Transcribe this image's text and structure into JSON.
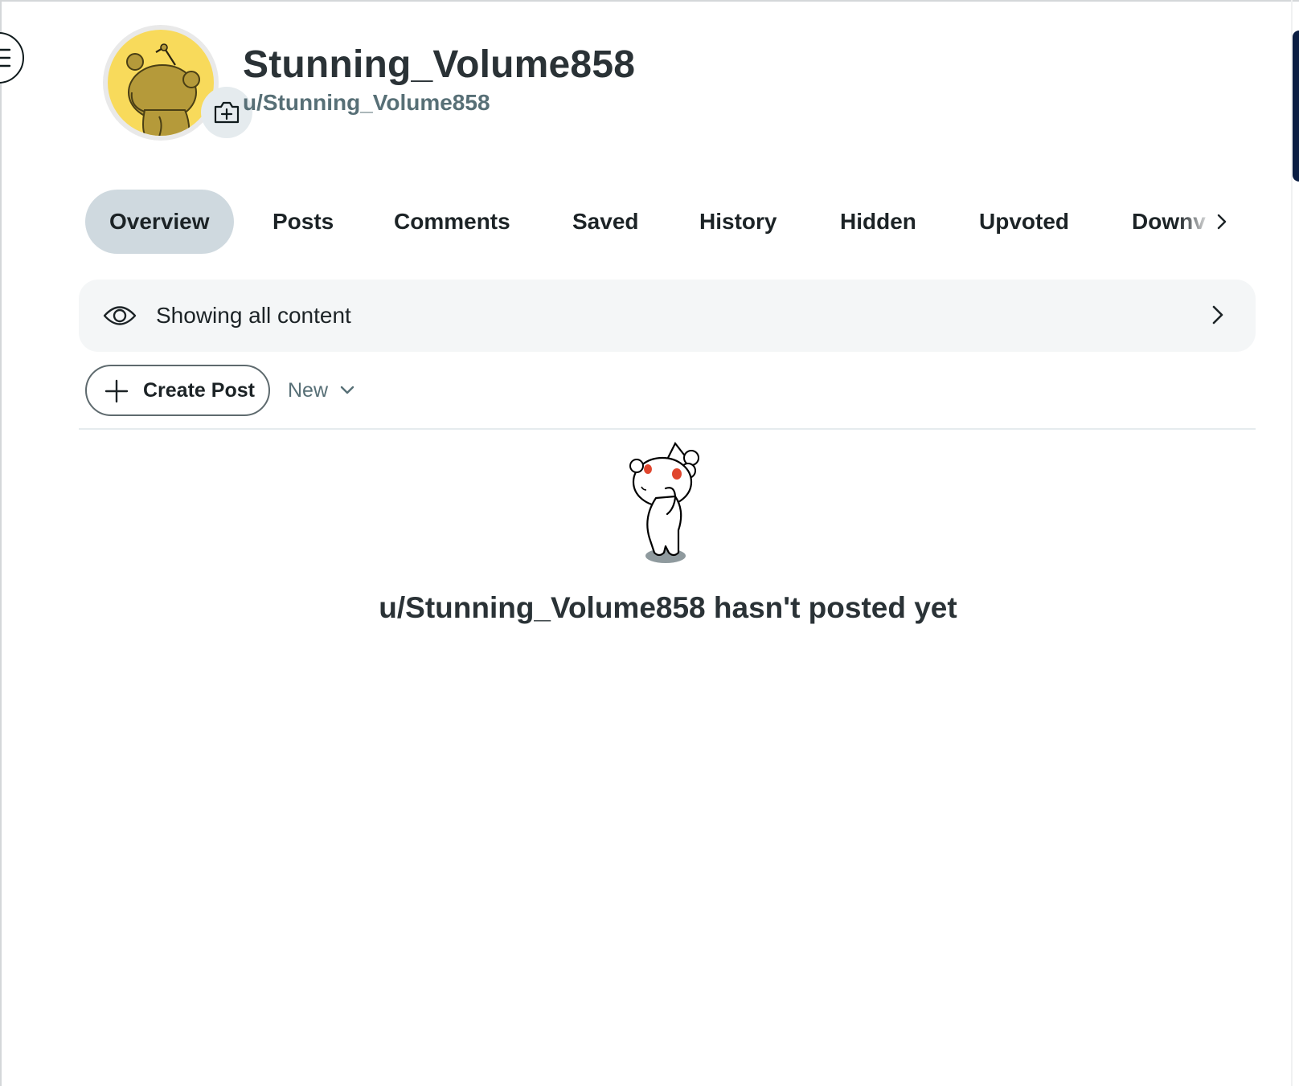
{
  "profile": {
    "display_name": "Stunning_Volume858",
    "username": "u/Stunning_Volume858",
    "avatar_color": "#f8da5b"
  },
  "tabs": [
    {
      "label": "Overview",
      "active": true
    },
    {
      "label": "Posts",
      "active": false
    },
    {
      "label": "Comments",
      "active": false
    },
    {
      "label": "Saved",
      "active": false
    },
    {
      "label": "History",
      "active": false
    },
    {
      "label": "Hidden",
      "active": false
    },
    {
      "label": "Upvoted",
      "active": false
    },
    {
      "label": "Downv",
      "active": false
    }
  ],
  "content_filter": {
    "label": "Showing all content",
    "icon": "eye-icon"
  },
  "toolbar": {
    "create_post_label": "Create Post",
    "sort_label": "New"
  },
  "empty_state": {
    "message": "u/Stunning_Volume858 hasn't posted yet"
  },
  "colors": {
    "active_tab_bg": "#cfd9df",
    "filter_bar_bg": "#f4f6f7",
    "secondary_text": "#576f76"
  }
}
